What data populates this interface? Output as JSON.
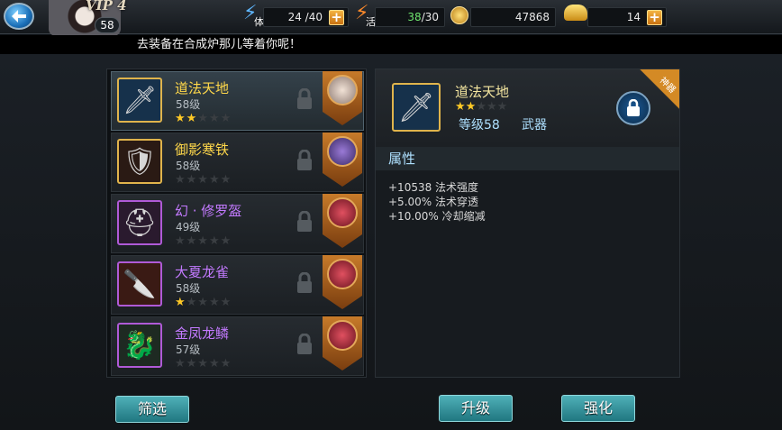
{
  "header": {
    "vip": "VIP 4",
    "level": "58",
    "stamina": {
      "icon": "lightning-icon",
      "label": "体",
      "value": "24 /40"
    },
    "activity": {
      "icon": "flame-icon",
      "label": "活",
      "value_current": "38",
      "value_total": "/30"
    },
    "coins": {
      "icon": "coin-icon",
      "value": "47868"
    },
    "gold": {
      "icon": "gold-ingot-icon",
      "value": "14"
    },
    "plus": "+"
  },
  "marquee": "去装备在合成炉那儿等着你呢！",
  "items": [
    {
      "name": "道法天地",
      "level": "58级",
      "stars": 2,
      "name_color": "#ffd84a",
      "icon": "sword-icon"
    },
    {
      "name": "御影寒铁",
      "level": "58级",
      "stars": 0,
      "name_color": "#ffd84a",
      "icon": "armor-icon"
    },
    {
      "name": "幻 · 修罗盔",
      "level": "49级",
      "stars": 0,
      "name_color": "#c37aff",
      "icon": "helmet-icon"
    },
    {
      "name": "大夏龙雀",
      "level": "58级",
      "stars": 1,
      "name_color": "#c37aff",
      "icon": "blade-icon"
    },
    {
      "name": "金凤龙鳞",
      "level": "57级",
      "stars": 0,
      "name_color": "#c37aff",
      "icon": "scale-armor-icon"
    }
  ],
  "detail": {
    "tag": "神器",
    "name": "道法天地",
    "stars": 2,
    "level": "等级58",
    "type": "武器",
    "attr_title": "属性",
    "attrs": [
      "+10538 法术强度",
      "+5.00% 法术穿透",
      "+10.00% 冷却缩减"
    ]
  },
  "buttons": {
    "filter": "筛选",
    "upgrade": "升级",
    "enhance": "强化"
  },
  "colors": {
    "accent": "#4fb0b8",
    "star": "#ffc926",
    "gold_name": "#ffd84a",
    "purple_name": "#c37aff"
  }
}
